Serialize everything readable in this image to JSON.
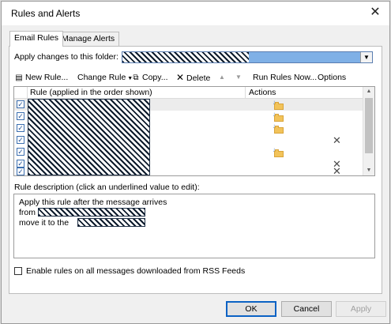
{
  "window": {
    "title": "Rules and Alerts",
    "close_glyph": "✕"
  },
  "tabs": [
    {
      "label": "Email Rules"
    },
    {
      "label": "Manage Alerts"
    }
  ],
  "folder": {
    "label": "Apply changes to this folder:"
  },
  "toolbar": {
    "new_rule": "New Rule...",
    "change_rule": "Change Rule",
    "copy": "Copy...",
    "delete": "Delete",
    "run_rules_now": "Run Rules Now...",
    "options": "Options"
  },
  "rules_table": {
    "columns": [
      "Rule (applied in the order shown)",
      "Actions"
    ],
    "rows": [
      {
        "checked": true,
        "action_icons": [
          "move-to-folder-icon"
        ]
      },
      {
        "checked": true,
        "action_icons": [
          "move-to-folder-icon"
        ]
      },
      {
        "checked": true,
        "action_icons": [
          "move-to-folder-icon"
        ]
      },
      {
        "checked": true,
        "action_icons": [
          "delete-x-icon"
        ]
      },
      {
        "checked": true,
        "action_icons": [
          "move-to-folder-icon"
        ]
      },
      {
        "checked": true,
        "action_icons": [
          "delete-x-icon"
        ]
      },
      {
        "checked": true,
        "action_icons": [
          "delete-x-icon"
        ]
      }
    ]
  },
  "description": {
    "label": "Rule description (click an underlined value to edit):",
    "line1": "Apply this rule after the message arrives",
    "line2": "from",
    "line3": "move it to the"
  },
  "rss": {
    "label": "Enable rules on all messages downloaded from RSS Feeds",
    "checked": false
  },
  "buttons": {
    "ok": "OK",
    "cancel": "Cancel",
    "apply": "Apply"
  },
  "colors": {
    "accent": "#0b62c4",
    "selection": "#7fb0e6",
    "folder": "#f2c35a"
  }
}
